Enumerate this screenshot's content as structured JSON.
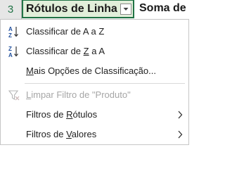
{
  "sheet": {
    "row_number": "3",
    "cell_a": "Rótulos de Linha",
    "cell_b": "Soma de V"
  },
  "menu": {
    "sort_az": {
      "pre": "Classificar de A a Z",
      "icon": "sort-ascending-az-icon"
    },
    "sort_za": {
      "pre": "Classificar de ",
      "ul": "Z",
      "post": " a A",
      "icon": "sort-descending-za-icon"
    },
    "more_sort": {
      "ul": "M",
      "post": "ais Opções de Classificação..."
    },
    "clear_filter": {
      "pre": "",
      "ul": "L",
      "post": "impar Filtro de \"Produto\"",
      "icon": "clear-filter-icon"
    },
    "label_filters": {
      "pre": "Filtros de ",
      "ul": "R",
      "post": "ótulos"
    },
    "value_filters": {
      "pre": "Filtros de ",
      "ul": "V",
      "post": "alores"
    }
  },
  "colors": {
    "excel_green": "#217346",
    "disabled_text": "#a6a6a6"
  }
}
